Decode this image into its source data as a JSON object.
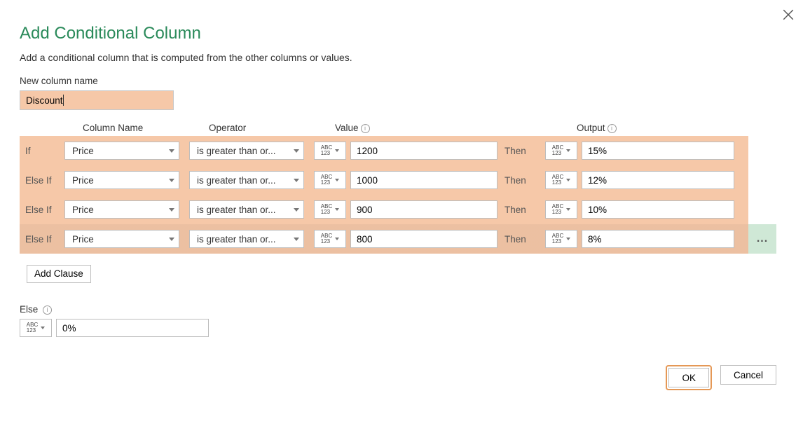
{
  "title": "Add Conditional Column",
  "subtitle": "Add a conditional column that is computed from the other columns or values.",
  "new_column_label": "New column name",
  "new_column_value": "Discount",
  "headers": {
    "column_name": "Column Name",
    "operator": "Operator",
    "value": "Value",
    "output": "Output"
  },
  "rows": [
    {
      "label": "If",
      "column": "Price",
      "operator": "is greater than or...",
      "value": "1200",
      "then": "Then",
      "output": "15%"
    },
    {
      "label": "Else If",
      "column": "Price",
      "operator": "is greater than or...",
      "value": "1000",
      "then": "Then",
      "output": "12%"
    },
    {
      "label": "Else If",
      "column": "Price",
      "operator": "is greater than or...",
      "value": "900",
      "then": "Then",
      "output": "10%"
    },
    {
      "label": "Else If",
      "column": "Price",
      "operator": "is greater than or...",
      "value": "800",
      "then": "Then",
      "output": "8%"
    }
  ],
  "type_icon_text": {
    "top": "ABC",
    "bottom": "123"
  },
  "more_label": "...",
  "add_clause": "Add Clause",
  "else_block": {
    "label": "Else",
    "value": "0%"
  },
  "footer": {
    "ok": "OK",
    "cancel": "Cancel"
  }
}
